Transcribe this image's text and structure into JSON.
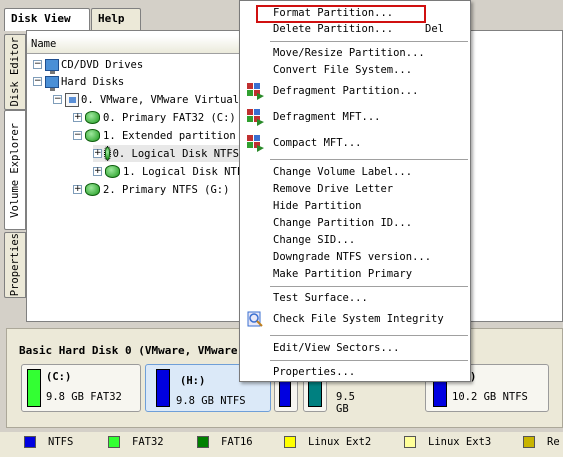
{
  "top_tabs": [
    "Disk View",
    "Help"
  ],
  "side_tabs": [
    "Disk Editor",
    "Volume Explorer",
    "Properties"
  ],
  "tree": {
    "column_header": "Name",
    "rows": [
      {
        "label": "CD/DVD Drives",
        "expander": "−"
      },
      {
        "label": "Hard Disks",
        "expander": "−"
      },
      {
        "label": "0. VMware, VMware Virtual",
        "expander": "−"
      },
      {
        "label": "0. Primary FAT32 (C:)",
        "expander": "+"
      },
      {
        "label": "1. Extended partition",
        "expander": "−"
      },
      {
        "label": "0. Logical Disk NTFS",
        "expander": "+"
      },
      {
        "label": "1. Logical Disk NTF",
        "expander": "+"
      },
      {
        "label": "2. Primary NTFS (G:)",
        "expander": "+"
      }
    ]
  },
  "disk_map": {
    "title": "Basic Hard Disk 0 (VMware, VMware",
    "partitions": [
      {
        "label": "(C:)",
        "size": "9.8 GB FAT32",
        "color": "#33ff33"
      },
      {
        "label": "(H:)",
        "size": "9.8 GB NTFS",
        "color": "#0000e0"
      },
      {
        "label": "",
        "size": "",
        "color": "#0000e0"
      },
      {
        "label": "",
        "size": "9.5 GB",
        "color": "#008080"
      },
      {
        "label": ")",
        "size": "10.2 GB NTFS",
        "color": "#0000e0"
      }
    ]
  },
  "legend": [
    {
      "label": "NTFS",
      "color": "#0000e0"
    },
    {
      "label": "FAT32",
      "color": "#33ff33"
    },
    {
      "label": "FAT16",
      "color": "#008000"
    },
    {
      "label": "Linux Ext2",
      "color": "#ffff00"
    },
    {
      "label": "Linux Ext3",
      "color": "#ffff99"
    },
    {
      "label": "Re",
      "color": "#c8b400"
    }
  ],
  "context_menu": {
    "items": [
      {
        "label": "Format Partition...",
        "name": "menu-format-partition"
      },
      {
        "label": "Delete Partition...",
        "shortcut": "Del",
        "name": "menu-delete-partition"
      },
      {
        "label": "Move/Resize Partition...",
        "name": "menu-move-resize"
      },
      {
        "label": "Convert File System...",
        "name": "menu-convert-fs"
      },
      {
        "label": "Defragment Partition...",
        "name": "menu-defragment-partition",
        "icon": "defrag-icon"
      },
      {
        "label": "Defragment MFT...",
        "name": "menu-defragment-mft",
        "icon": "defrag-mft-icon"
      },
      {
        "label": "Compact MFT...",
        "name": "menu-compact-mft",
        "icon": "compact-mft-icon"
      },
      {
        "label": "Change Volume Label...",
        "name": "menu-change-label"
      },
      {
        "label": "Remove Drive Letter",
        "name": "menu-remove-letter"
      },
      {
        "label": "Hide Partition",
        "name": "menu-hide-partition"
      },
      {
        "label": "Change Partition ID...",
        "name": "menu-change-id"
      },
      {
        "label": "Change SID...",
        "name": "menu-change-sid"
      },
      {
        "label": "Downgrade NTFS version...",
        "name": "menu-downgrade-ntfs"
      },
      {
        "label": "Make Partition Primary",
        "name": "menu-make-primary"
      },
      {
        "label": "Test Surface...",
        "name": "menu-test-surface"
      },
      {
        "label": "Check File System Integrity",
        "name": "menu-check-fs",
        "icon": "check-fs-icon"
      },
      {
        "label": "Edit/View Sectors...",
        "name": "menu-edit-sectors"
      },
      {
        "label": "Properties...",
        "name": "menu-properties"
      }
    ],
    "highlight_color": "#d01010"
  }
}
